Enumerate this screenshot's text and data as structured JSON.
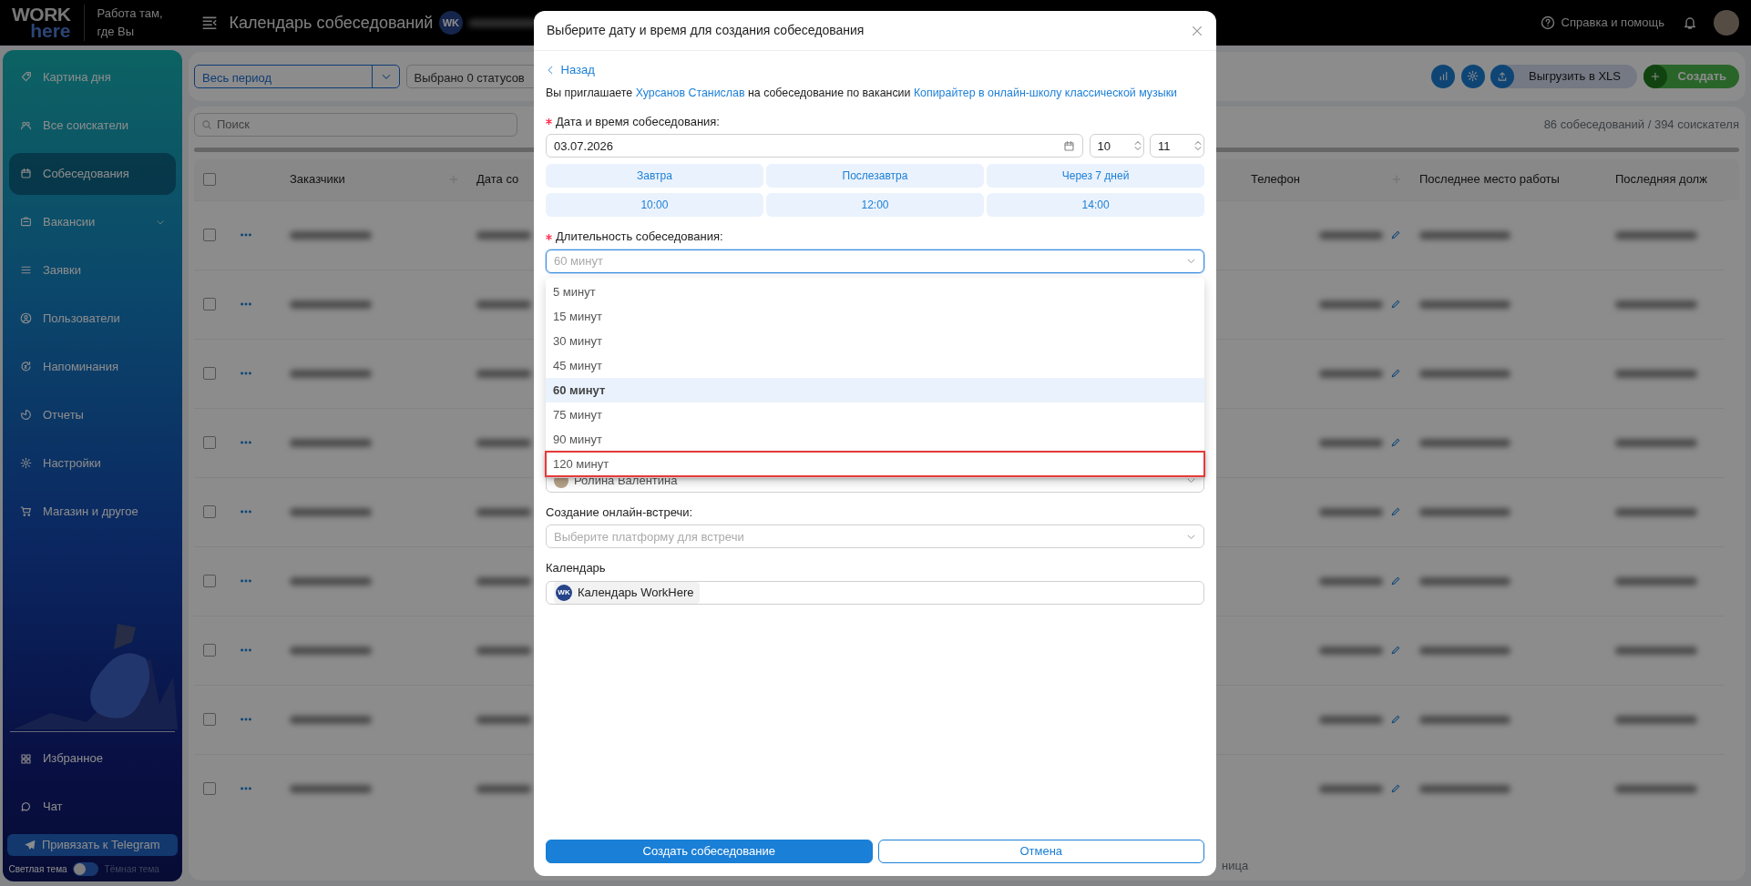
{
  "topbar": {
    "logo_top": "WORK",
    "logo_bottom": "here",
    "tagline_lines": [
      "Работа там,",
      "где Вы"
    ],
    "page_title": "Календарь собеседований",
    "calendar_badge": "WK",
    "help": "Справка и помощь"
  },
  "sidebar": {
    "items": [
      {
        "label": "Картина дня",
        "selected": false,
        "expandable": false
      },
      {
        "label": "Все соискатели",
        "selected": false,
        "expandable": false
      },
      {
        "label": "Собеседования",
        "selected": true,
        "expandable": false
      },
      {
        "label": "Вакансии",
        "selected": false,
        "expandable": true
      },
      {
        "label": "Заявки",
        "selected": false,
        "expandable": false
      },
      {
        "label": "Пользователи",
        "selected": false,
        "expandable": false
      },
      {
        "label": "Напоминания",
        "selected": false,
        "expandable": false
      },
      {
        "label": "Отчеты",
        "selected": false,
        "expandable": false
      },
      {
        "label": "Настройки",
        "selected": false,
        "expandable": false
      },
      {
        "label": "Магазин и другое",
        "selected": false,
        "expandable": false
      }
    ],
    "bottom_items": [
      {
        "label": "Избранное"
      },
      {
        "label": "Чат"
      }
    ],
    "telegram_button": "Привязать к Telegram",
    "theme": {
      "light_label": "Светлая тема",
      "dark_label": "Тёмная тема",
      "dark": false
    }
  },
  "toolbar": {
    "period": "Весь период",
    "statuses": "Выбрано 0 статусов",
    "export": "Выгрузить в XLS",
    "create": "Создать"
  },
  "table": {
    "search_placeholder": "Поиск",
    "counter": "86 собеседований / 394 соискателя",
    "select_all_checked": false,
    "columns": [
      "Заказчики",
      "Дата со",
      "Телефон",
      "Последнее место работы",
      "Последняя долж"
    ],
    "rows": [
      {
        "checked": false
      },
      {
        "checked": false
      },
      {
        "checked": false
      },
      {
        "checked": false
      },
      {
        "checked": false
      },
      {
        "checked": false
      },
      {
        "checked": false
      },
      {
        "checked": false
      },
      {
        "checked": false
      }
    ],
    "footer_fragment": "ница"
  },
  "modal": {
    "title": "Выберите дату и время для создания собеседования",
    "back": "Назад",
    "invite": [
      {
        "kind": "text",
        "text": "Вы приглашаете "
      },
      {
        "kind": "link",
        "text": "Хурсанов Станислав"
      },
      {
        "kind": "text",
        "text": " на собеседование по вакансии "
      },
      {
        "kind": "link",
        "text": "Копирайтер в онлайн-школу классической музыки"
      }
    ],
    "datetime": {
      "label": "Дата и время собеседования:",
      "required": true,
      "date": "03.07.2026",
      "hour": "10",
      "minute": "11"
    },
    "day_buttons": [
      "Завтра",
      "Послезавтра",
      "Через 7 дней"
    ],
    "time_buttons": [
      "10:00",
      "12:00",
      "14:00"
    ],
    "duration": {
      "label": "Длительность собеседования:",
      "required": true,
      "value": "60 минут",
      "open": true,
      "options": [
        {
          "label": "5 минут",
          "selected": false,
          "outlined": false
        },
        {
          "label": "15 минут",
          "selected": false,
          "outlined": false
        },
        {
          "label": "30 минут",
          "selected": false,
          "outlined": false
        },
        {
          "label": "45 минут",
          "selected": false,
          "outlined": false
        },
        {
          "label": "60 минут",
          "selected": true,
          "outlined": false
        },
        {
          "label": "75 минут",
          "selected": false,
          "outlined": false
        },
        {
          "label": "90 минут",
          "selected": false,
          "outlined": false
        },
        {
          "label": "120 минут",
          "selected": false,
          "outlined": true
        }
      ]
    },
    "organizer": {
      "name": "Ролина Валентина"
    },
    "meeting": {
      "label": "Создание онлайн-встречи:",
      "placeholder": "Выберите платформу для встречи"
    },
    "calendar": {
      "label": "Календарь",
      "tag_badge": "WK",
      "tag": "Календарь WorkHere"
    },
    "submit": "Создать собеседование",
    "cancel": "Отмена"
  }
}
